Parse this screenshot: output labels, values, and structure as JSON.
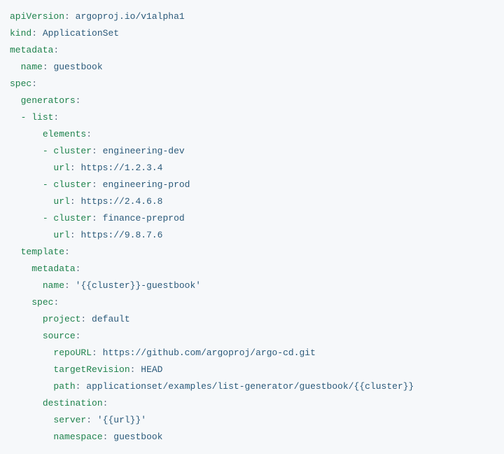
{
  "lines": [
    {
      "indent": 0,
      "key": "apiVersion",
      "sep": ":",
      "space": " ",
      "val": "argoproj.io/v1alpha1"
    },
    {
      "indent": 0,
      "key": "kind",
      "sep": ":",
      "space": " ",
      "val": "ApplicationSet"
    },
    {
      "indent": 0,
      "key": "metadata",
      "sep": ":"
    },
    {
      "indent": 2,
      "key": "name",
      "sep": ":",
      "space": " ",
      "val": "guestbook"
    },
    {
      "indent": 0,
      "key": "spec",
      "sep": ":"
    },
    {
      "indent": 2,
      "key": "generators",
      "sep": ":"
    },
    {
      "indent": 2,
      "key": "- list",
      "sep": ":"
    },
    {
      "indent": 6,
      "key": "elements",
      "sep": ":"
    },
    {
      "indent": 6,
      "key": "- cluster",
      "sep": ":",
      "space": " ",
      "val": "engineering-dev"
    },
    {
      "indent": 8,
      "key": "url",
      "sep": ":",
      "space": " ",
      "val": "https://1.2.3.4"
    },
    {
      "indent": 6,
      "key": "- cluster",
      "sep": ":",
      "space": " ",
      "val": "engineering-prod"
    },
    {
      "indent": 8,
      "key": "url",
      "sep": ":",
      "space": " ",
      "val": "https://2.4.6.8"
    },
    {
      "indent": 6,
      "key": "- cluster",
      "sep": ":",
      "space": " ",
      "val": "finance-preprod"
    },
    {
      "indent": 8,
      "key": "url",
      "sep": ":",
      "space": " ",
      "val": "https://9.8.7.6"
    },
    {
      "indent": 2,
      "key": "template",
      "sep": ":"
    },
    {
      "indent": 4,
      "key": "metadata",
      "sep": ":"
    },
    {
      "indent": 6,
      "key": "name",
      "sep": ":",
      "space": " ",
      "val": "'{{cluster}}-guestbook'"
    },
    {
      "indent": 4,
      "key": "spec",
      "sep": ":"
    },
    {
      "indent": 6,
      "key": "project",
      "sep": ":",
      "space": " ",
      "val": "default"
    },
    {
      "indent": 6,
      "key": "source",
      "sep": ":"
    },
    {
      "indent": 8,
      "key": "repoURL",
      "sep": ":",
      "space": " ",
      "val": "https://github.com/argoproj/argo-cd.git"
    },
    {
      "indent": 8,
      "key": "targetRevision",
      "sep": ":",
      "space": " ",
      "val": "HEAD"
    },
    {
      "indent": 8,
      "key": "path",
      "sep": ":",
      "space": " ",
      "val": "applicationset/examples/list-generator/guestbook/{{cluster}}"
    },
    {
      "indent": 6,
      "key": "destination",
      "sep": ":"
    },
    {
      "indent": 8,
      "key": "server",
      "sep": ":",
      "space": " ",
      "val": "'{{url}}'"
    },
    {
      "indent": 8,
      "key": "namespace",
      "sep": ":",
      "space": " ",
      "val": "guestbook"
    }
  ]
}
